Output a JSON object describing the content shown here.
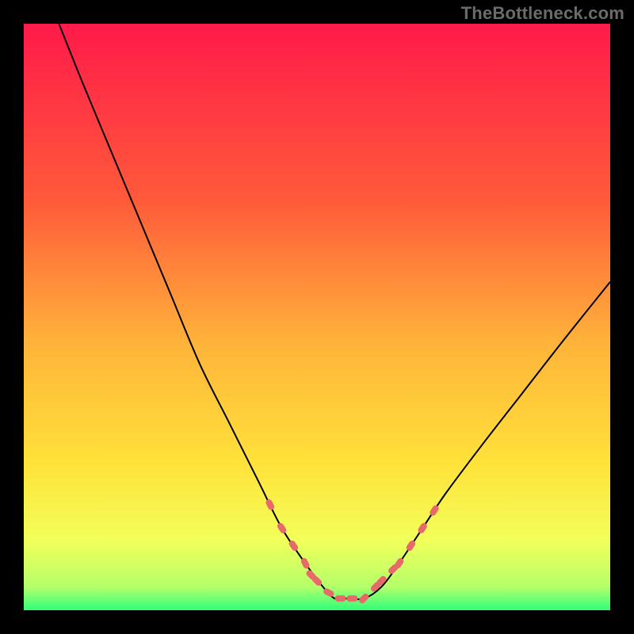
{
  "watermark": "TheBottleneck.com",
  "chart_data": {
    "type": "line",
    "title": "",
    "xlabel": "",
    "ylabel": "",
    "xlim": [
      0,
      100
    ],
    "ylim": [
      0,
      100
    ],
    "curve": {
      "x": [
        6,
        10,
        15,
        20,
        25,
        30,
        35,
        40,
        44,
        48,
        51,
        53,
        55,
        58,
        61,
        64,
        68,
        72,
        78,
        85,
        92,
        100
      ],
      "y": [
        100,
        90,
        78,
        66,
        54,
        42,
        32,
        22,
        14,
        8,
        4,
        2,
        2,
        2,
        4,
        8,
        14,
        20,
        28,
        37,
        46,
        56
      ]
    },
    "highlight_points": {
      "x": [
        42,
        44,
        46,
        48,
        49,
        50,
        52,
        54,
        56,
        58,
        60,
        61,
        63,
        64,
        66,
        68,
        70
      ],
      "y": [
        18,
        14,
        11,
        8,
        6,
        5,
        3,
        2,
        2,
        2,
        4,
        5,
        7,
        8,
        11,
        14,
        17
      ]
    },
    "background_gradient": {
      "stops": [
        {
          "pos": 0.0,
          "color": "#ff1a4a"
        },
        {
          "pos": 0.3,
          "color": "#ff5a3a"
        },
        {
          "pos": 0.55,
          "color": "#ffb53a"
        },
        {
          "pos": 0.75,
          "color": "#ffe23a"
        },
        {
          "pos": 0.88,
          "color": "#f3ff5a"
        },
        {
          "pos": 0.96,
          "color": "#b4ff6a"
        },
        {
          "pos": 1.0,
          "color": "#2fff7a"
        }
      ]
    }
  }
}
